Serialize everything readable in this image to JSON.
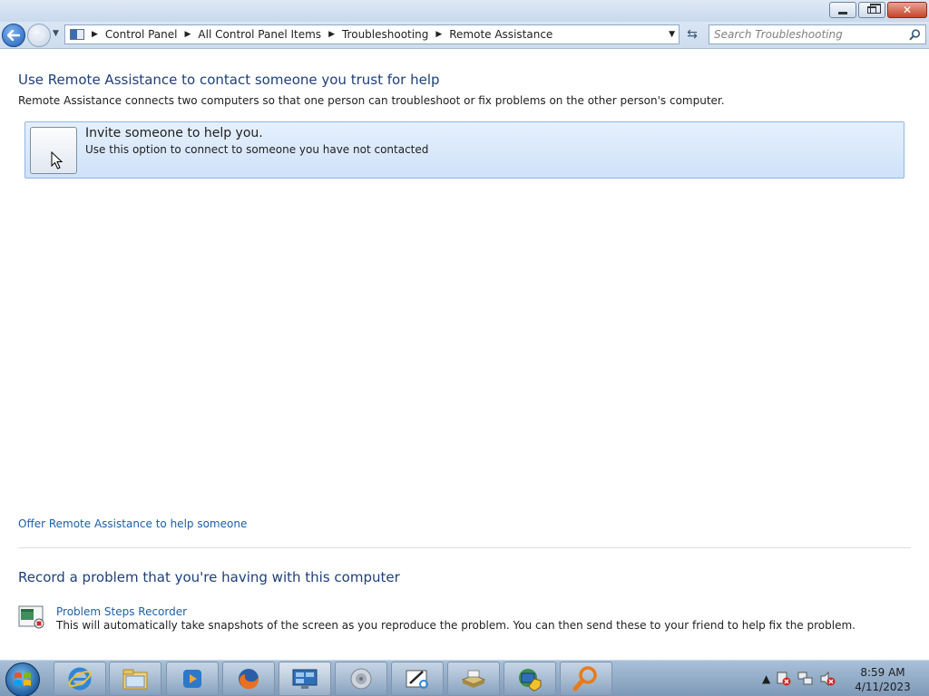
{
  "window": {
    "minimize_icon": "minimize-icon",
    "maximize_icon": "restore-icon",
    "close_icon": "close-icon"
  },
  "address_bar": {
    "breadcrumbs": [
      "Control Panel",
      "All Control Panel Items",
      "Troubleshooting",
      "Remote Assistance"
    ],
    "search_placeholder": "Search Troubleshooting"
  },
  "main": {
    "heading": "Use Remote Assistance to contact someone you trust for help",
    "description": "Remote Assistance connects two computers so that one person can troubleshoot or fix problems on the other person's computer.",
    "invite_option": {
      "title": "Invite someone to help you.",
      "subtitle": "Use this option to connect to someone you have not contacted"
    },
    "offer_link": "Offer Remote Assistance to help someone",
    "record_heading": "Record a problem that you're having with this computer",
    "psr": {
      "link": "Problem Steps Recorder",
      "description": "This will automatically take snapshots of the screen as you reproduce the problem. You can then send these to your friend to help fix the problem."
    }
  },
  "taskbar": {
    "items": [
      "internet-explorer-icon",
      "windows-explorer-icon",
      "media-player-icon",
      "firefox-icon",
      "remote-desktop-icon",
      "speaker-icon",
      "snipping-tool-icon",
      "scanner-icon",
      "network-shield-icon",
      "magnifier-icon"
    ],
    "clock_time": "8:59 AM",
    "clock_date": "4/11/2023"
  },
  "colors": {
    "heading": "#1e3f7a",
    "link": "#1c5fa8",
    "option_bg": "#d8e8fb",
    "taskbar": "#8fa9c6"
  }
}
